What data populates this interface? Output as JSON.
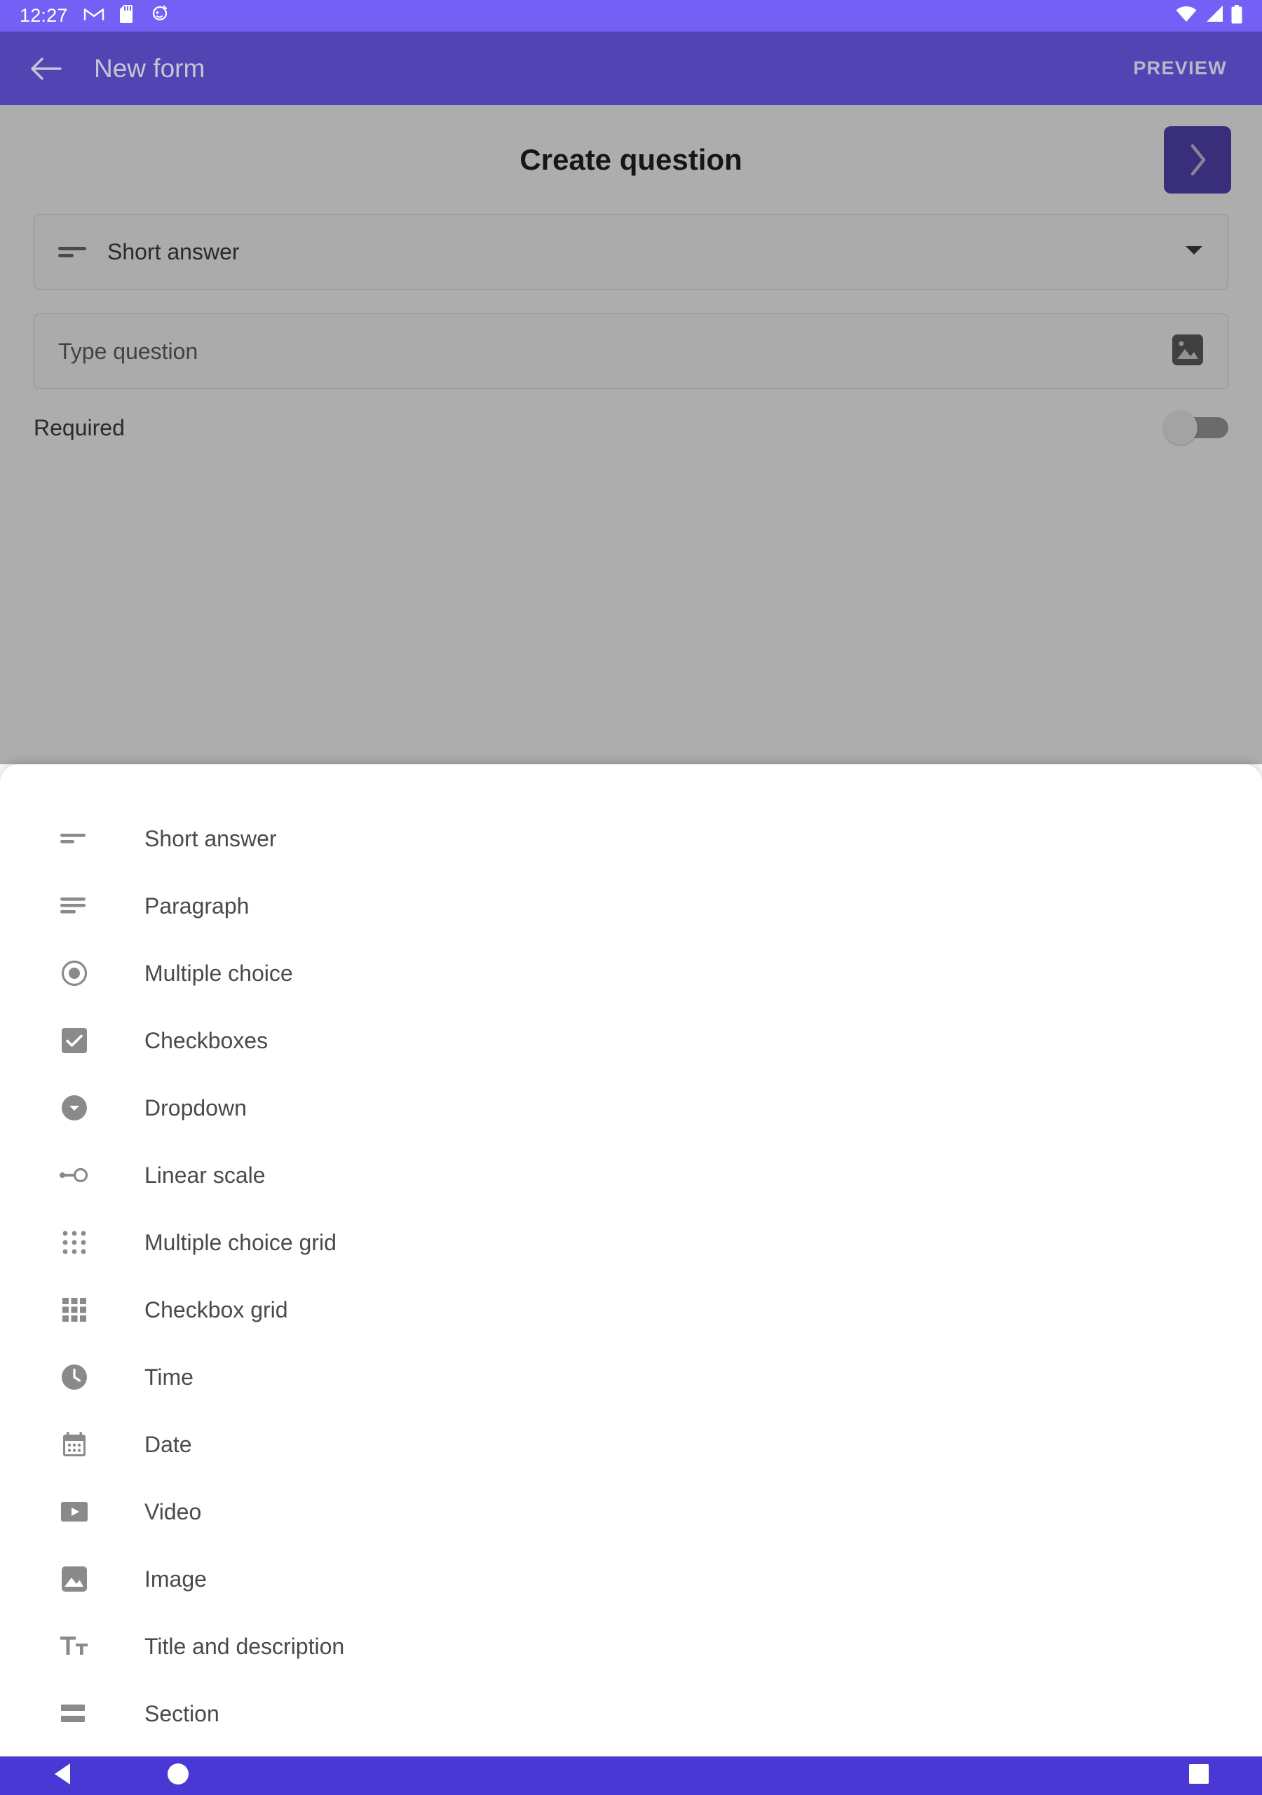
{
  "status_bar": {
    "time": "12:27",
    "left_icons": [
      "gmail-icon",
      "sd-card-icon",
      "bug-droid-icon"
    ],
    "right_icons": [
      "wifi-icon",
      "cellular-signal-icon",
      "battery-icon"
    ],
    "background_color": "#7460f5"
  },
  "app_bar": {
    "back_label": "Back",
    "title": "New form",
    "preview_label": "PREVIEW",
    "background_color": "#5344b3"
  },
  "main": {
    "heading": "Create question",
    "next_button_label": "›",
    "question_type": {
      "value": "Short answer",
      "icon": "short-answer-icon"
    },
    "question_input": {
      "placeholder": "Type question",
      "value": "",
      "image_button_icon": "image-icon"
    },
    "required": {
      "label": "Required",
      "enabled": false
    }
  },
  "sheet": {
    "items": [
      {
        "label": "Short answer",
        "icon": "short-answer-icon"
      },
      {
        "label": "Paragraph",
        "icon": "paragraph-icon"
      },
      {
        "label": "Multiple choice",
        "icon": "radio-button-icon"
      },
      {
        "label": "Checkboxes",
        "icon": "checkbox-icon"
      },
      {
        "label": "Dropdown",
        "icon": "dropdown-circle-icon"
      },
      {
        "label": "Linear scale",
        "icon": "linear-scale-icon"
      },
      {
        "label": "Multiple choice grid",
        "icon": "radio-grid-icon"
      },
      {
        "label": "Checkbox grid",
        "icon": "checkbox-grid-icon"
      },
      {
        "label": "Time",
        "icon": "clock-icon"
      },
      {
        "label": "Date",
        "icon": "calendar-icon"
      },
      {
        "label": "Video",
        "icon": "video-icon"
      },
      {
        "label": "Image",
        "icon": "image-icon"
      },
      {
        "label": "Title and description",
        "icon": "title-text-icon"
      },
      {
        "label": "Section",
        "icon": "section-icon"
      }
    ]
  },
  "nav_bar": {
    "back_icon": "nav-back-triangle-icon",
    "home_icon": "nav-home-circle-icon",
    "recents_icon": "nav-recents-square-icon",
    "background_color": "#4a38d4"
  },
  "colors": {
    "accent": "#5344b3",
    "status_bar": "#7460f5",
    "nav_bar": "#4a38d4",
    "icon_gray": "#8a8a8a",
    "text_primary": "#3c4043"
  }
}
